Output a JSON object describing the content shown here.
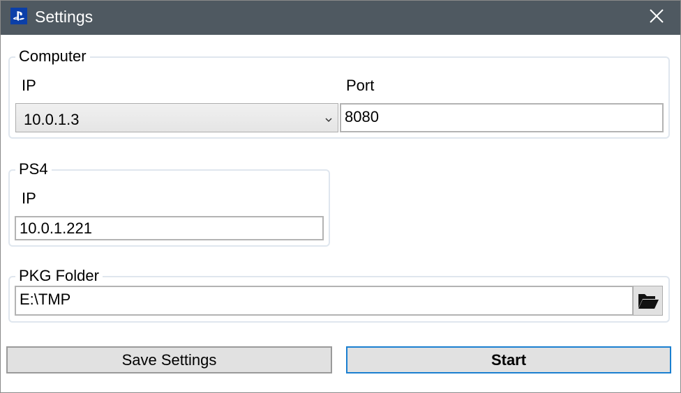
{
  "window": {
    "title": "Settings",
    "icons": {
      "app": "playstation-icon",
      "close": "close-icon"
    }
  },
  "computer": {
    "legend": "Computer",
    "ip_label": "IP",
    "ip_value": "10.0.1.3",
    "port_label": "Port",
    "port_value": "8080"
  },
  "ps4": {
    "legend": "PS4",
    "ip_label": "IP",
    "ip_value": "10.0.1.221"
  },
  "pkg": {
    "legend": "PKG Folder",
    "path_value": "E:\\TMP",
    "browse_icon": "folder-open-icon"
  },
  "actions": {
    "save_label": "Save Settings",
    "start_label": "Start"
  },
  "colors": {
    "titlebar": "#4f5961",
    "accent": "#1a7fd0",
    "group_border": "#dfe6ee"
  }
}
